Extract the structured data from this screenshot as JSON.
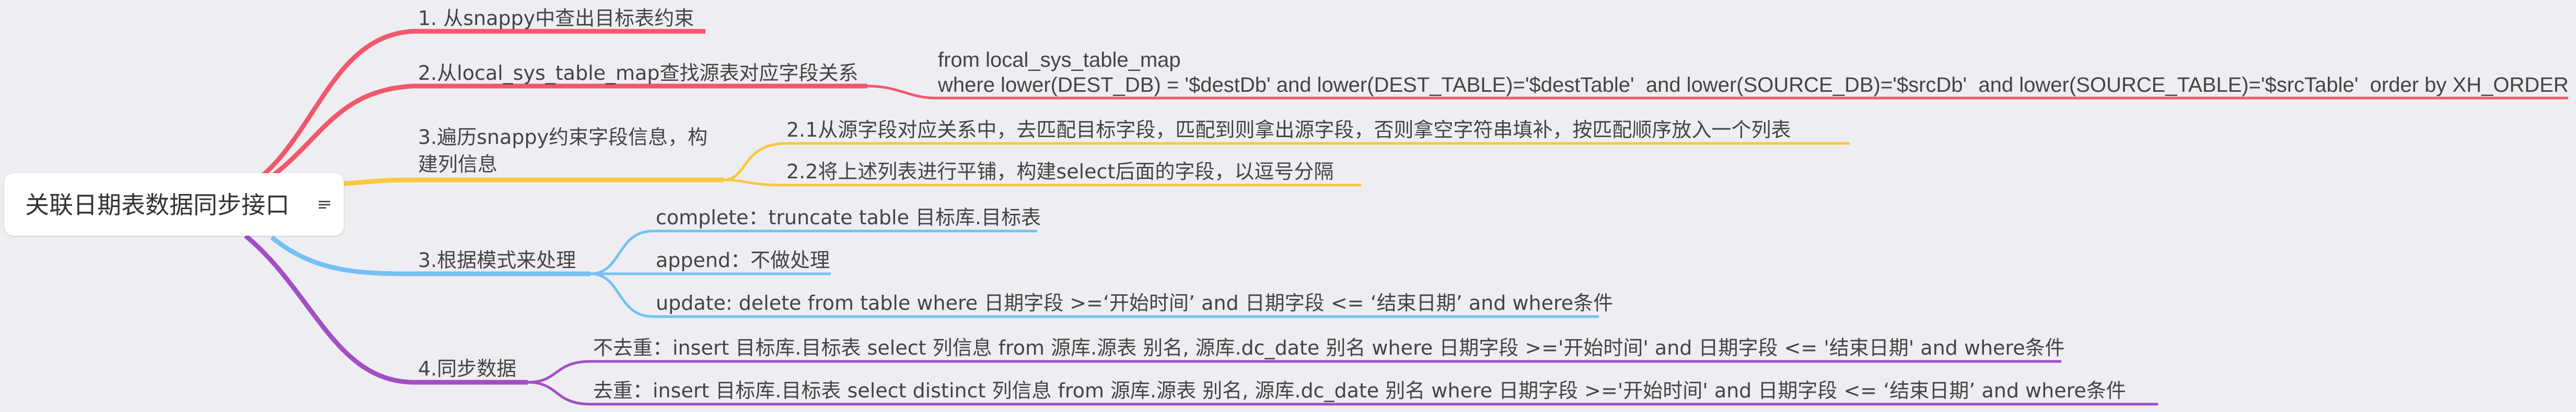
{
  "root": {
    "title": "关联日期表数据同步接口",
    "notes_icon": "notes-icon"
  },
  "branches": [
    {
      "key": "b1",
      "color": "#f0596b",
      "label": "1. 从snappy中查出目标表约束",
      "children": []
    },
    {
      "key": "b2",
      "color": "#f0596b",
      "label": "2.从local_sys_table_map查找源表对应字段关系",
      "children": [
        {
          "key": "b2c1",
          "lines": [
            "from local_sys_table_map",
            "where lower(DEST_DB) = '$destDb' and lower(DEST_TABLE)='$destTable'  and lower(SOURCE_DB)='$srcDb'  and lower(SOURCE_TABLE)='$srcTable'  order by XH_ORDER"
          ]
        }
      ]
    },
    {
      "key": "b3",
      "color": "#f9c842",
      "lines": [
        "3.遍历snappy约束字段信息，构",
        "建列信息"
      ],
      "children": [
        {
          "key": "b3c1",
          "label": "2.1从源字段对应关系中，去匹配目标字段，匹配到则拿出源字段，否则拿空字符串填补，按匹配顺序放入一个列表"
        },
        {
          "key": "b3c2",
          "label": "2.2将上述列表进行平铺，构建select后面的字段，以逗号分隔"
        }
      ]
    },
    {
      "key": "b4",
      "color": "#75c1f5",
      "label": "3.根据模式来处理",
      "children": [
        {
          "key": "b4c1",
          "label": "complete：truncate table 目标库.目标表"
        },
        {
          "key": "b4c2",
          "label": "append：不做处理"
        },
        {
          "key": "b4c3",
          "label": "update: delete from table where 日期字段 >=‘开始时间’ and 日期字段 <= ‘结束日期’ and where条件"
        }
      ]
    },
    {
      "key": "b5",
      "color": "#a14fc4",
      "label": "4.同步数据",
      "children": [
        {
          "key": "b5c1",
          "label": "不去重：insert 目标库.目标表 select 列信息 from 源库.源表 别名, 源库.dc_date 别名 where 日期字段 >='开始时间' and 日期字段 <= '结束日期' and where条件"
        },
        {
          "key": "b5c2",
          "label": "去重：insert 目标库.目标表 select distinct 列信息 from 源库.源表 别名, 源库.dc_date 别名 where 日期字段 >='开始时间' and 日期字段 <= ‘结束日期’ and where条件"
        }
      ]
    }
  ]
}
